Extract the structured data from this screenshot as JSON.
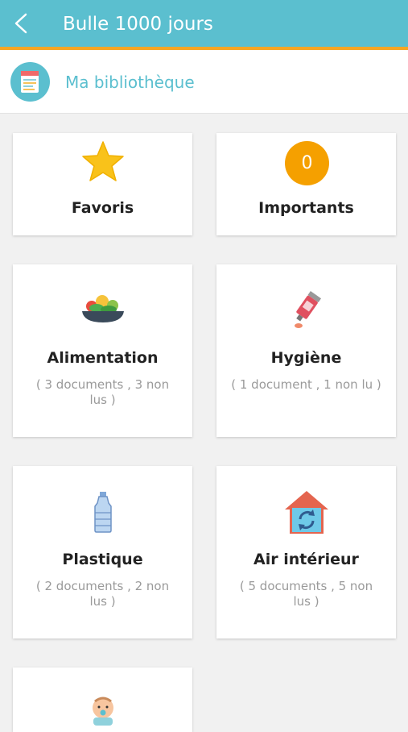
{
  "header": {
    "title": "Bulle 1000 jours"
  },
  "library": {
    "title": "Ma bibliothèque"
  },
  "badge": {
    "count": "0"
  },
  "cards": [
    {
      "name": "Favoris",
      "icon": "star-icon"
    },
    {
      "name": "Importants",
      "icon": "count-badge"
    },
    {
      "name": "Alimentation",
      "sub": "( 3 documents , 3 non lus )",
      "icon": "salad-bowl-icon"
    },
    {
      "name": "Hygiène",
      "sub": "( 1 document , 1 non lu )",
      "icon": "cream-tube-icon"
    },
    {
      "name": "Plastique",
      "sub": "( 2 documents , 2 non lus )",
      "icon": "water-bottle-icon"
    },
    {
      "name": "Air intérieur",
      "sub": "( 5 documents , 5 non lus )",
      "icon": "house-refresh-icon"
    },
    {
      "icon": "baby-icon"
    }
  ],
  "colors": {
    "header": "#5bbfcf",
    "accent": "#f6a623",
    "badge": "#f5a000"
  }
}
